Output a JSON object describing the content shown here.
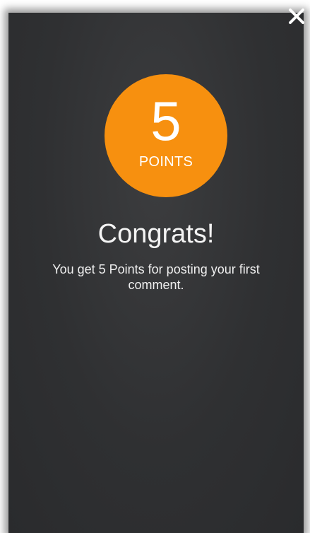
{
  "badge": {
    "number": "5",
    "unit": "POINTS",
    "color": "#f7900f"
  },
  "title": "Congrats!",
  "message": "You get 5 Points for posting your first comment.",
  "close_icon": "close-icon"
}
